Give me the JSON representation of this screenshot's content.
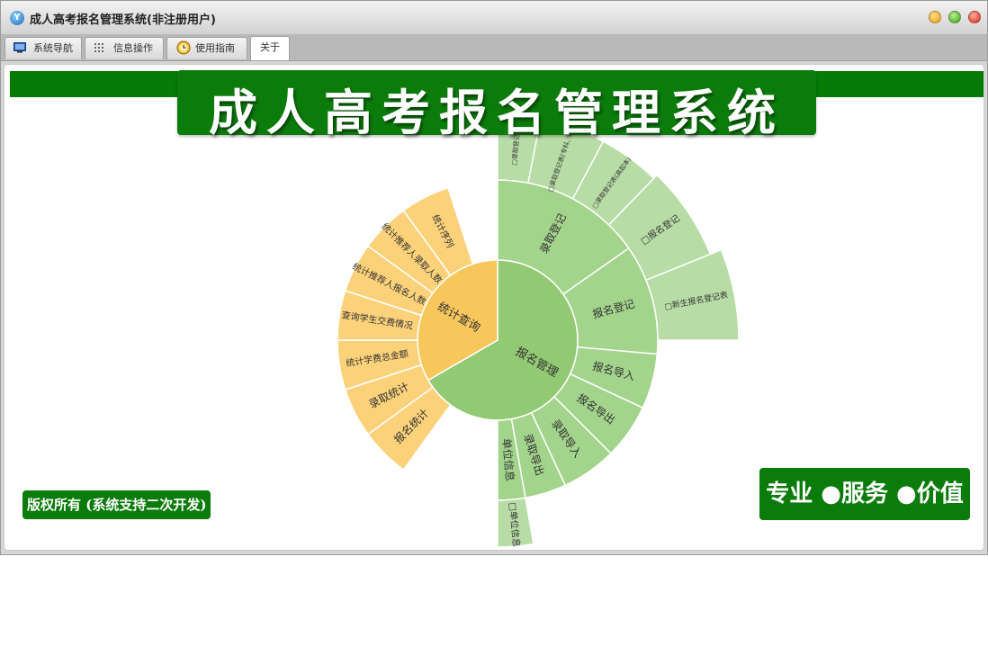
{
  "window": {
    "title": "成人高考报名管理系统(非注册用户)",
    "app_icon_glyph": "Y"
  },
  "tabs": [
    {
      "label": "系统导航",
      "icon": "monitor-icon"
    },
    {
      "label": "信息操作",
      "icon": "grid-icon"
    },
    {
      "label": "使用指南",
      "icon": "clock-icon"
    },
    {
      "label": "关于",
      "icon": ""
    }
  ],
  "active_tab": 3,
  "banner": {
    "text": "成人高考报名管理系统"
  },
  "copyright": "版权所有 (系统支持二次开发)",
  "slogan": "专业 ●服务 ●价值",
  "colors": {
    "brand_green": "#0b7c0b",
    "registration_center": "#92c973",
    "registration_ring": "#a3d48b",
    "registration_outer": "#b7dca5",
    "statistics_center": "#f8c75c",
    "statistics_ring": "#fbd27a"
  },
  "sunburst": {
    "registration": {
      "label": "报名管理",
      "children": [
        {
          "label": "录取登记",
          "children": [
            "□录取登记表",
            "□录取登记表(专科、本科)",
            "□录取登记表(高起本)"
          ]
        },
        {
          "label": "报名登记",
          "children": [
            "□报名登记",
            "□新生报名登记表"
          ]
        },
        {
          "label": "报名导入",
          "children": []
        },
        {
          "label": "报名导出",
          "children": []
        },
        {
          "label": "录取导入",
          "children": []
        },
        {
          "label": "录取导出",
          "children": []
        },
        {
          "label": "单位信息",
          "children": [
            "□单位信息"
          ]
        }
      ]
    },
    "statistics": {
      "label": "统计查询",
      "children": [
        "报名统计",
        "录取统计",
        "统计学费总金额",
        "查询学生交费情况",
        "统计推荐人报名人数",
        "统计推荐人录取人数",
        "统计序列"
      ]
    }
  }
}
